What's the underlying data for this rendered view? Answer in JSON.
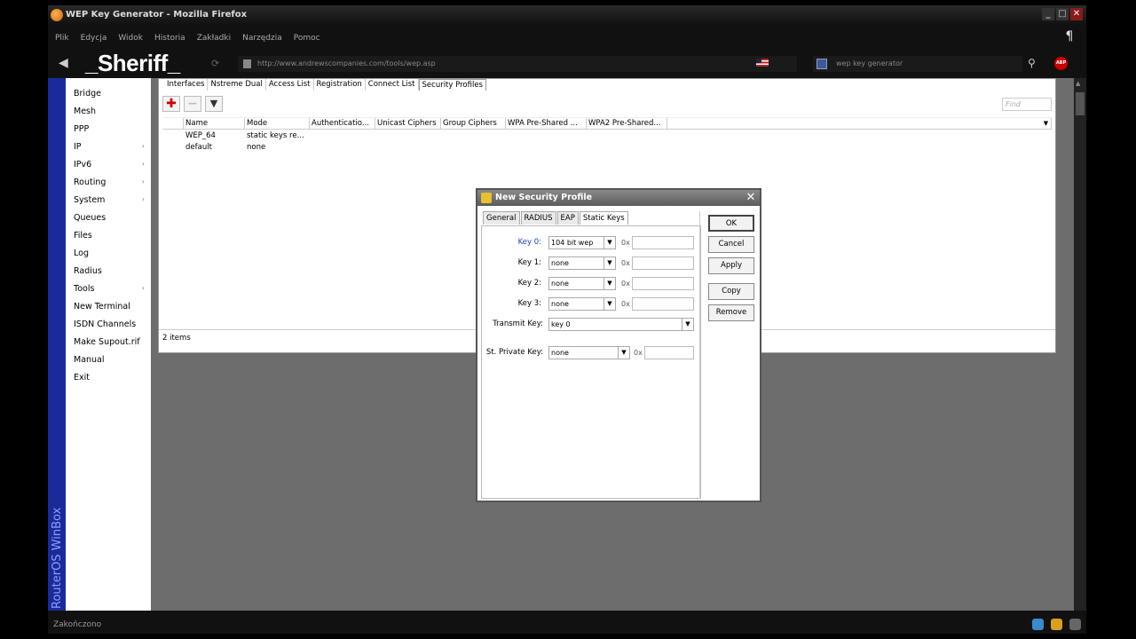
{
  "browser": {
    "title": "WEP Key Generator - Mozilla Firefox",
    "menu": [
      "Plik",
      "Edycja",
      "Widok",
      "Historia",
      "Zakładki",
      "Narzędzia",
      "Pomoc"
    ],
    "overlay_text": "_Sheriff_",
    "url": "http://www.andrewscompanies.com/tools/wep.asp",
    "search_text": "wep key generator",
    "status": "Zakończono"
  },
  "winbox": {
    "brand": "RouterOS WinBox",
    "sidebar": [
      {
        "label": "Bridge",
        "arrow": ""
      },
      {
        "label": "Mesh",
        "arrow": ""
      },
      {
        "label": "PPP",
        "arrow": ""
      },
      {
        "label": "IP",
        "arrow": "›"
      },
      {
        "label": "IPv6",
        "arrow": "›"
      },
      {
        "label": "Routing",
        "arrow": "›"
      },
      {
        "label": "System",
        "arrow": "›"
      },
      {
        "label": "Queues",
        "arrow": ""
      },
      {
        "label": "Files",
        "arrow": ""
      },
      {
        "label": "Log",
        "arrow": ""
      },
      {
        "label": "Radius",
        "arrow": ""
      },
      {
        "label": "Tools",
        "arrow": "›"
      },
      {
        "label": "New Terminal",
        "arrow": ""
      },
      {
        "label": "ISDN Channels",
        "arrow": ""
      },
      {
        "label": "Make Supout.rif",
        "arrow": ""
      },
      {
        "label": "Manual",
        "arrow": ""
      },
      {
        "label": "Exit",
        "arrow": ""
      }
    ],
    "tabs": [
      "Interfaces",
      "Nstreme Dual",
      "Access List",
      "Registration",
      "Connect List",
      "Security Profiles"
    ],
    "find_placeholder": "Find",
    "columns": [
      "Name",
      "Mode",
      "Authenticatio...",
      "Unicast Ciphers",
      "Group Ciphers",
      "WPA Pre-Shared ...",
      "WPA2 Pre-Shared..."
    ],
    "rows": [
      {
        "name": "WEP_64",
        "mode": "static keys re..."
      },
      {
        "name": "default",
        "mode": "none"
      }
    ],
    "items_count": "2 items"
  },
  "dialog": {
    "title": "New Security Profile",
    "tabs": [
      "General",
      "RADIUS",
      "EAP",
      "Static Keys"
    ],
    "buttons": {
      "ok": "OK",
      "cancel": "Cancel",
      "apply": "Apply",
      "copy": "Copy",
      "remove": "Remove"
    },
    "keys": [
      {
        "label": "Key 0:",
        "value": "104 bit wep",
        "prefix": "0x"
      },
      {
        "label": "Key 1:",
        "value": "none",
        "prefix": "0x"
      },
      {
        "label": "Key 2:",
        "value": "none",
        "prefix": "0x"
      },
      {
        "label": "Key 3:",
        "value": "none",
        "prefix": "0x"
      }
    ],
    "transmit_key": {
      "label": "Transmit Key:",
      "value": "key 0"
    },
    "private_key": {
      "label": "St. Private Key:",
      "value": "none",
      "prefix": "0x"
    }
  }
}
